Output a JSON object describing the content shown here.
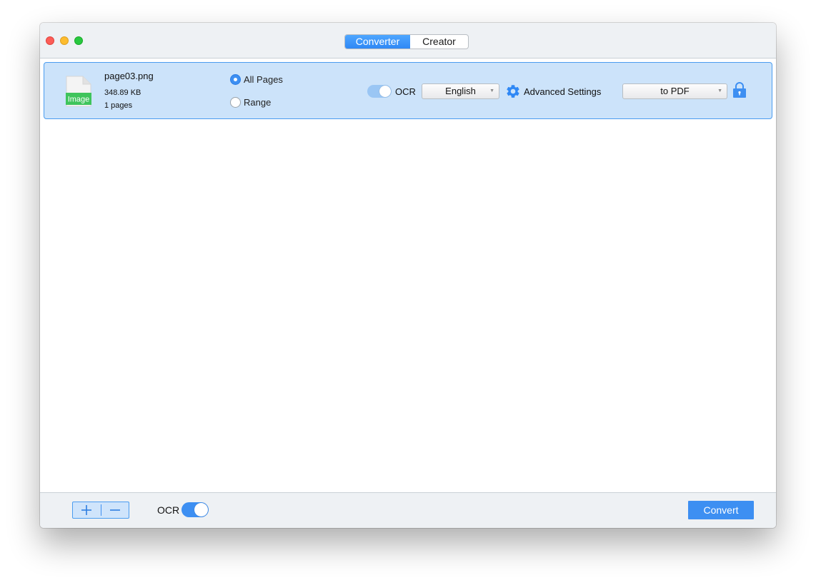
{
  "window": {
    "tabs": [
      {
        "label": "Converter",
        "active": true
      },
      {
        "label": "Creator",
        "active": false
      }
    ]
  },
  "file": {
    "icon_label": "Image",
    "name": "page03.png",
    "size": "348.89 KB",
    "pages": "1 pages",
    "page_options": [
      {
        "label": "All Pages",
        "selected": true
      },
      {
        "label": "Range",
        "selected": false
      }
    ],
    "ocr_toggle": {
      "label": "OCR",
      "on": true
    },
    "language": "English",
    "advanced_settings_label": "Advanced Settings",
    "output_format": "to PDF"
  },
  "bottom": {
    "ocr_label": "OCR",
    "ocr_on": true,
    "convert_label": "Convert"
  },
  "colors": {
    "accent": "#3d8ff2",
    "row_bg": "#cce3fa",
    "file_icon_badge": "#3fc45c"
  },
  "icons": [
    "add-icon",
    "remove-icon",
    "gear-icon",
    "lock-icon",
    "image-file-icon"
  ]
}
